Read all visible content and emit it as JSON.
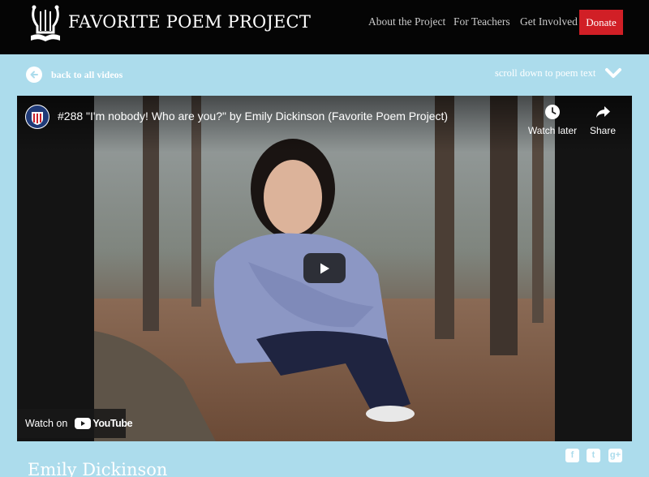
{
  "header": {
    "site_title": "FAVORITE POEM PROJECT",
    "logo_icon": "lyre-book-icon",
    "nav": [
      "About the Project",
      "For Teachers",
      "Get Involved"
    ],
    "donate_label": "Donate",
    "donate_color": "#d11f26",
    "background": "#050505"
  },
  "subnav": {
    "back_label": "back to all videos",
    "back_icon": "arrow-left-circle-icon",
    "scroll_label": "scroll down to poem text",
    "scroll_icon": "chevron-down-icon"
  },
  "video": {
    "title": "#288 \"I'm nobody! Who are you?\" by Emily Dickinson (Favorite Poem Project)",
    "watch_later_label": "Watch later",
    "share_label": "Share",
    "watch_on_label": "Watch on",
    "youtube_label": "YouTube",
    "play_icon": "play-icon",
    "player_background": "#141414"
  },
  "social": {
    "facebook": "f",
    "twitter": "t",
    "googleplus": "g+"
  },
  "poet_name": "Emily Dickinson",
  "theme": {
    "page_background": "#acdcec",
    "accent_red": "#d11f26"
  }
}
